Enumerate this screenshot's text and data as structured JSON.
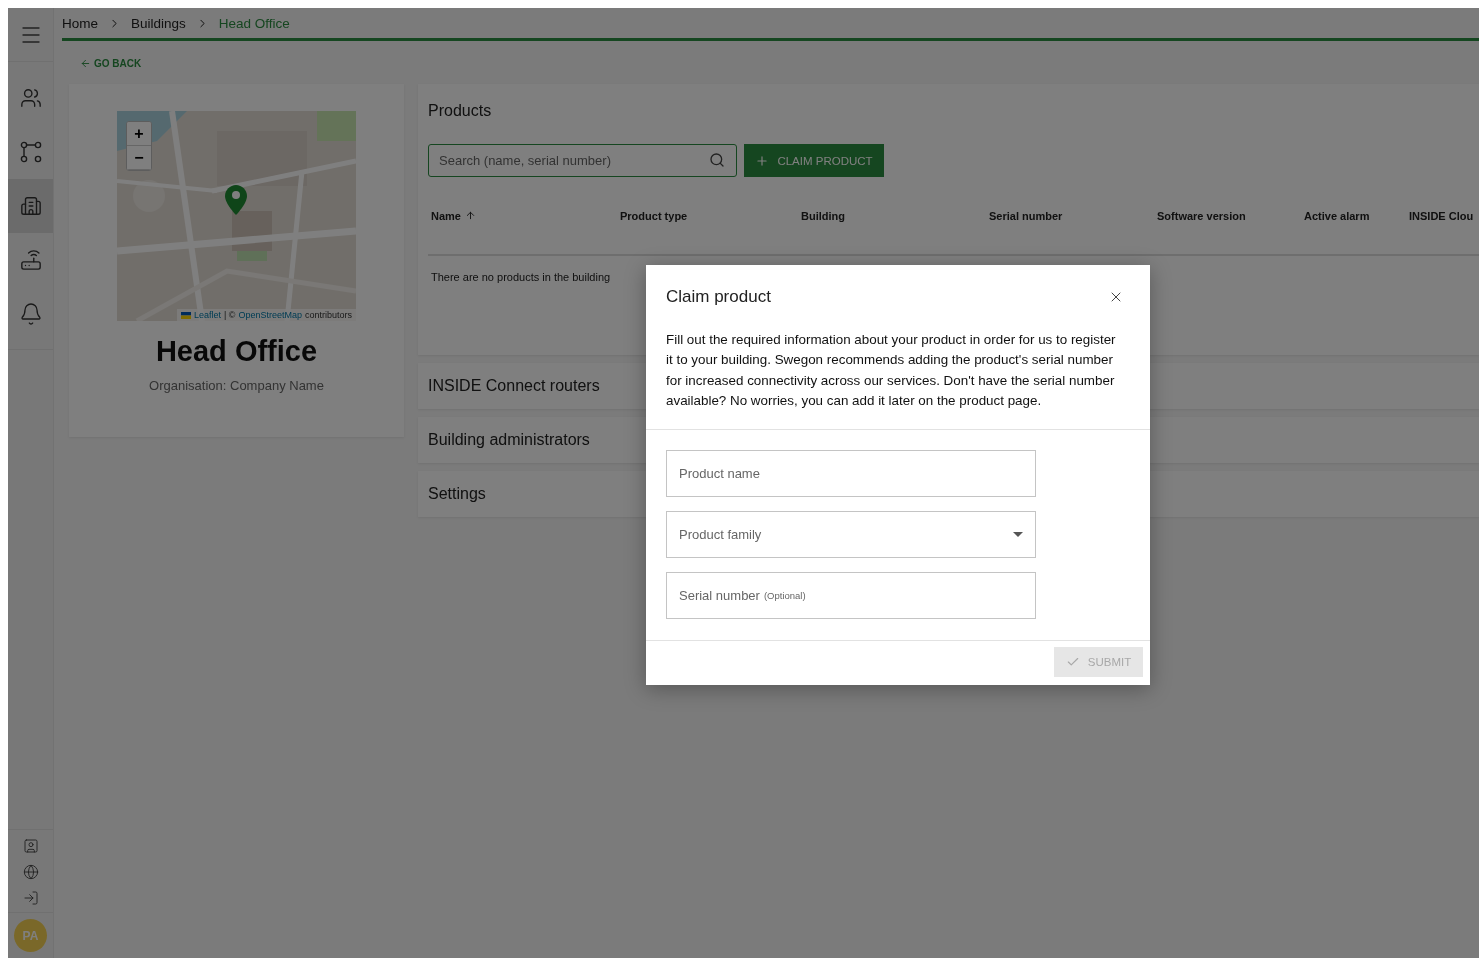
{
  "sidebar": {
    "items": [
      {
        "kind": "people",
        "selected": false
      },
      {
        "kind": "network",
        "selected": false
      },
      {
        "kind": "building",
        "selected": true
      },
      {
        "kind": "router",
        "selected": false
      },
      {
        "kind": "bell",
        "selected": false
      }
    ],
    "bottom_items": [
      {
        "kind": "contact"
      },
      {
        "kind": "globe"
      },
      {
        "kind": "logout"
      }
    ],
    "avatar": {
      "initials": "PA"
    }
  },
  "breadcrumb": [
    {
      "label": "Home",
      "current": false
    },
    {
      "label": "Buildings",
      "current": false
    },
    {
      "label": "Head Office",
      "current": true
    }
  ],
  "go_back": "GO BACK",
  "building_card": {
    "map": {
      "kind": "picture",
      "zoom_in": "+",
      "zoom_out": "−",
      "attribution": [
        {
          "kind": "link",
          "text": "Leaflet"
        },
        {
          "kind": "text",
          "text": "| ©"
        },
        {
          "kind": "link",
          "text": "OpenStreetMap"
        },
        {
          "kind": "text",
          "text": "contributors"
        }
      ]
    },
    "title": "Head Office",
    "organisation": "Organisation: Company Name"
  },
  "products": {
    "title": "Products",
    "search": {
      "placeholder": "Search (name, serial number)"
    },
    "claim_button": "CLAIM PRODUCT",
    "columns": [
      {
        "label": "Name",
        "sorted": true
      },
      {
        "label": "Product type",
        "sorted": false
      },
      {
        "label": "Building",
        "sorted": false
      },
      {
        "label": "Serial number",
        "sorted": false
      },
      {
        "label": "Software version",
        "sorted": false
      },
      {
        "label": "Active alarm",
        "sorted": false
      },
      {
        "label": "INSIDE Clou",
        "sorted": false
      }
    ],
    "empty_text": "There are no products in the building"
  },
  "sections": [
    "INSIDE Connect routers",
    "Building administrators",
    "Settings"
  ],
  "dialog": {
    "title": "Claim product",
    "description": "Fill out the required information about your product in order for us to register it to your building. Swegon recommends adding the product's serial number for increased connectivity across our services. Don't have the serial number available? No worries, you can add it later on the product page.",
    "fields": [
      {
        "kind": "text",
        "label": "Product name"
      },
      {
        "kind": "select",
        "label": "Product family"
      },
      {
        "kind": "text",
        "label": "Serial number",
        "note": "(Optional)"
      }
    ],
    "submit": {
      "label": "SUBMIT",
      "disabled": true
    }
  }
}
